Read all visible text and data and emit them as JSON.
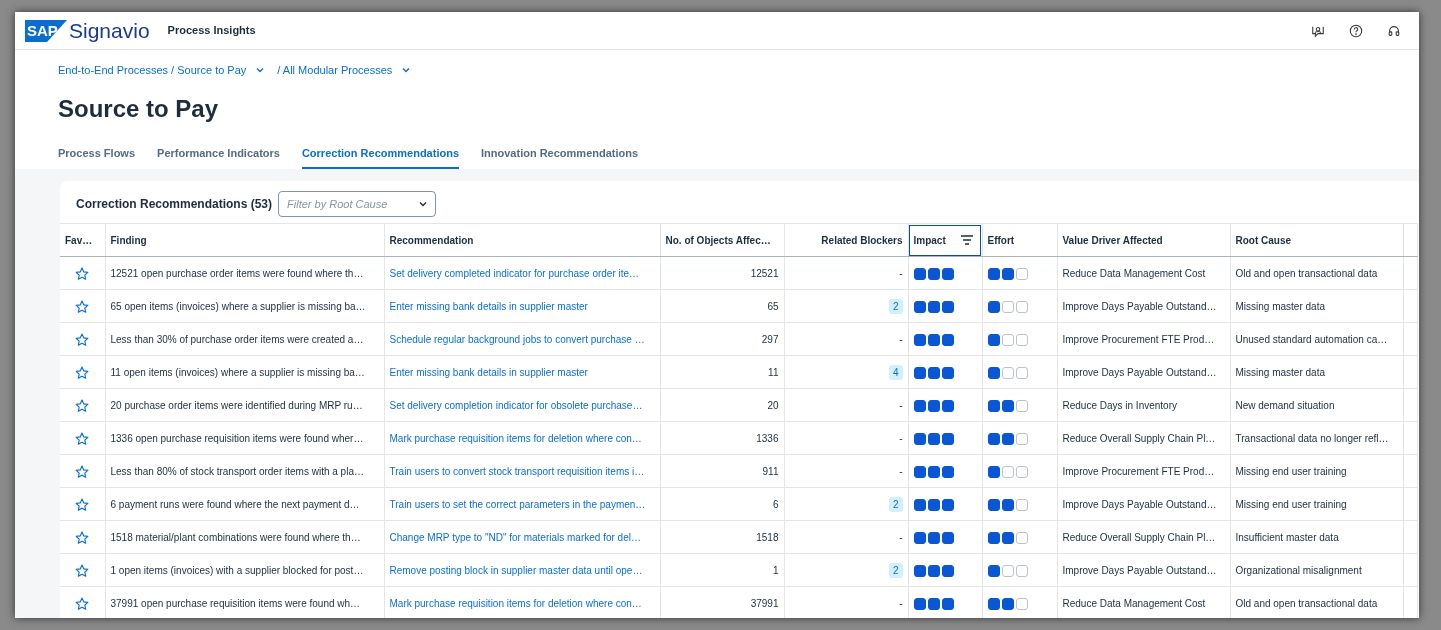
{
  "header": {
    "logo_mark": "SAP",
    "logo_name": "Signavio",
    "product": "Process Insights"
  },
  "breadcrumb": [
    {
      "label": "End-to-End Processes / Source to Pay"
    },
    {
      "label": "/ All Modular Processes"
    }
  ],
  "page_title": "Source to Pay",
  "tabs": [
    {
      "label": "Process Flows",
      "selected": false
    },
    {
      "label": "Performance Indicators",
      "selected": false
    },
    {
      "label": "Correction Recommendations",
      "selected": true
    },
    {
      "label": "Innovation Recommendations",
      "selected": false
    }
  ],
  "card": {
    "title": "Correction Recommendations (53)",
    "filter": {
      "placeholder": "Filter by Root Cause"
    }
  },
  "table": {
    "columns": [
      {
        "label": "Fav…",
        "focused": false,
        "filtered": false
      },
      {
        "label": "Finding",
        "focused": false,
        "filtered": false
      },
      {
        "label": "Recommendation",
        "focused": false,
        "filtered": false
      },
      {
        "label": "No. of Objects Affec…",
        "focused": false,
        "filtered": false
      },
      {
        "label": "Related Blockers",
        "focused": false,
        "filtered": false
      },
      {
        "label": "Impact",
        "focused": true,
        "filtered": true
      },
      {
        "label": "Effort",
        "focused": false,
        "filtered": false
      },
      {
        "label": "Value Driver Affected",
        "focused": false,
        "filtered": false
      },
      {
        "label": "Root Cause",
        "focused": false,
        "filtered": false
      }
    ],
    "rows": [
      {
        "favorite": false,
        "finding": "12521 open purchase order items were found where th…",
        "recommendation": "Set delivery completed indicator for purchase order ite…",
        "objects": "12521",
        "blockers": {
          "text": "-",
          "badge": false
        },
        "impact": {
          "stars": 3
        },
        "effort": {
          "stars": 2
        },
        "value_driver": "Reduce Data Management Cost",
        "root_cause": "Old and open transactional data"
      },
      {
        "favorite": false,
        "finding": "65 open items (invoices) where a supplier is missing ba…",
        "recommendation": "Enter missing bank details in supplier master",
        "objects": "65",
        "blockers": {
          "text": "2",
          "badge": true
        },
        "impact": {
          "stars": 3
        },
        "effort": {
          "stars": 1
        },
        "value_driver": "Improve Days Payable Outstand…",
        "root_cause": "Missing master data"
      },
      {
        "favorite": false,
        "finding": "Less than 30% of purchase order items were created a…",
        "recommendation": "Schedule regular background jobs to convert purchase …",
        "objects": "297",
        "blockers": {
          "text": "-",
          "badge": false
        },
        "impact": {
          "stars": 3
        },
        "effort": {
          "stars": 1
        },
        "value_driver": "Improve Procurement FTE Prod…",
        "root_cause": "Unused standard automation ca…"
      },
      {
        "favorite": false,
        "finding": "11 open items (invoices) where a supplier is missing ba…",
        "recommendation": "Enter missing bank details in supplier master",
        "objects": "11",
        "blockers": {
          "text": "4",
          "badge": true
        },
        "impact": {
          "stars": 3
        },
        "effort": {
          "stars": 1
        },
        "value_driver": "Improve Days Payable Outstand…",
        "root_cause": "Missing master data"
      },
      {
        "favorite": false,
        "finding": "20 purchase order items were identified during MRP ru…",
        "recommendation": "Set delivery completion indicator for obsolete purchase…",
        "objects": "20",
        "blockers": {
          "text": "-",
          "badge": false
        },
        "impact": {
          "stars": 3
        },
        "effort": {
          "stars": 2
        },
        "value_driver": "Reduce Days in Inventory",
        "root_cause": "New demand situation"
      },
      {
        "favorite": false,
        "finding": "1336 open purchase requisition items were found wher…",
        "recommendation": "Mark purchase requisition items for deletion where con…",
        "objects": "1336",
        "blockers": {
          "text": "-",
          "badge": false
        },
        "impact": {
          "stars": 3
        },
        "effort": {
          "stars": 2
        },
        "value_driver": "Reduce Overall Supply Chain Pl…",
        "root_cause": "Transactional data no longer refl…"
      },
      {
        "favorite": false,
        "finding": "Less than 80% of stock transport order items with a pla…",
        "recommendation": "Train users to convert stock transport requisition items i…",
        "objects": "911",
        "blockers": {
          "text": "-",
          "badge": false
        },
        "impact": {
          "stars": 3
        },
        "effort": {
          "stars": 1
        },
        "value_driver": "Improve Procurement FTE Prod…",
        "root_cause": "Missing end user training"
      },
      {
        "favorite": false,
        "finding": "6 payment runs were found where the next payment d…",
        "recommendation": "Train users to set the correct parameters in the paymen…",
        "objects": "6",
        "blockers": {
          "text": "2",
          "badge": true
        },
        "impact": {
          "stars": 3
        },
        "effort": {
          "stars": 2
        },
        "value_driver": "Improve Days Payable Outstand…",
        "root_cause": "Missing end user training"
      },
      {
        "favorite": false,
        "finding": "1518 material/plant combinations were found where th…",
        "recommendation": "Change MRP type to \"ND\" for materials marked for del…",
        "objects": "1518",
        "blockers": {
          "text": "-",
          "badge": false
        },
        "impact": {
          "stars": 3
        },
        "effort": {
          "stars": 2
        },
        "value_driver": "Reduce Overall Supply Chain Pl…",
        "root_cause": "Insufficient master data"
      },
      {
        "favorite": false,
        "finding": "1 open items (invoices) with a supplier blocked for post…",
        "recommendation": "Remove posting block in supplier master data until ope…",
        "objects": "1",
        "blockers": {
          "text": "2",
          "badge": true
        },
        "impact": {
          "stars": 3
        },
        "effort": {
          "stars": 1
        },
        "value_driver": "Improve Days Payable Outstand…",
        "root_cause": "Organizational misalignment"
      },
      {
        "favorite": false,
        "finding": "37991 open purchase requisition items were found wh…",
        "recommendation": "Mark purchase requisition items for deletion where con…",
        "objects": "37991",
        "blockers": {
          "text": "-",
          "badge": false
        },
        "impact": {
          "stars": 3
        },
        "effort": {
          "stars": 2
        },
        "value_driver": "Reduce Data Management Cost",
        "root_cause": "Old and open transactional data"
      }
    ]
  }
}
